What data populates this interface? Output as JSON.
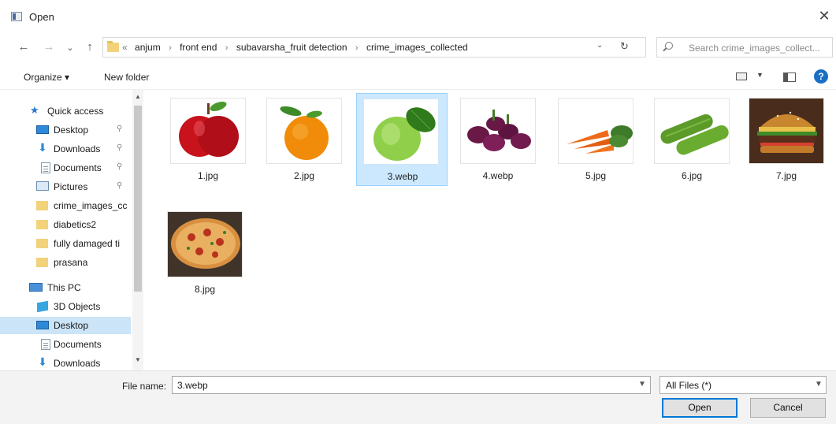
{
  "window": {
    "title": "Open",
    "close_glyph": "✕"
  },
  "nav": {
    "back": "←",
    "forward": "→",
    "recent": "⌄",
    "up": "↑"
  },
  "address": {
    "crumbs": [
      "«",
      "anjum",
      "front end",
      "subavarsha_fruit detection",
      "crime_images_collected"
    ],
    "separator": "›",
    "dropdown": "⌄",
    "refresh": "↻"
  },
  "search": {
    "placeholder": "Search crime_images_collect..."
  },
  "toolbar": {
    "organize": "Organize ▾",
    "new_folder": "New folder",
    "help": "?"
  },
  "sidebar": {
    "items": [
      {
        "label": "Quick access",
        "icon": "star-icon",
        "pinned": false
      },
      {
        "label": "Desktop",
        "icon": "desktop-icon",
        "pinned": true
      },
      {
        "label": "Downloads",
        "icon": "download-icon",
        "pinned": true
      },
      {
        "label": "Documents",
        "icon": "document-icon",
        "pinned": true
      },
      {
        "label": "Pictures",
        "icon": "pictures-icon",
        "pinned": true
      },
      {
        "label": "crime_images_cc",
        "icon": "folder-icon",
        "pinned": false
      },
      {
        "label": "diabetics2",
        "icon": "folder-icon",
        "pinned": false
      },
      {
        "label": "fully damaged ti",
        "icon": "folder-icon",
        "pinned": false
      },
      {
        "label": "prasana",
        "icon": "folder-icon",
        "pinned": false
      },
      {
        "label": "This PC",
        "icon": "pc-icon",
        "pinned": false
      },
      {
        "label": "3D Objects",
        "icon": "3d-objects-icon",
        "pinned": false
      },
      {
        "label": "Desktop",
        "icon": "desktop-icon",
        "pinned": false,
        "selected": true
      },
      {
        "label": "Documents",
        "icon": "document-icon",
        "pinned": false
      },
      {
        "label": "Downloads",
        "icon": "download-icon",
        "pinned": false
      }
    ],
    "pin_glyph": "📌"
  },
  "files": [
    {
      "name": "1.jpg",
      "kind": "apple"
    },
    {
      "name": "2.jpg",
      "kind": "orange"
    },
    {
      "name": "3.webp",
      "kind": "guava",
      "selected": true
    },
    {
      "name": "4.webp",
      "kind": "eggplant"
    },
    {
      "name": "5.jpg",
      "kind": "carrot"
    },
    {
      "name": "6.jpg",
      "kind": "cucumber"
    },
    {
      "name": "7.jpg",
      "kind": "burger"
    },
    {
      "name": "8.jpg",
      "kind": "pizza"
    }
  ],
  "footer": {
    "file_name_label": "File name:",
    "file_name_value": "3.webp",
    "file_type": "All Files (*)",
    "open": "Open",
    "cancel": "Cancel"
  }
}
